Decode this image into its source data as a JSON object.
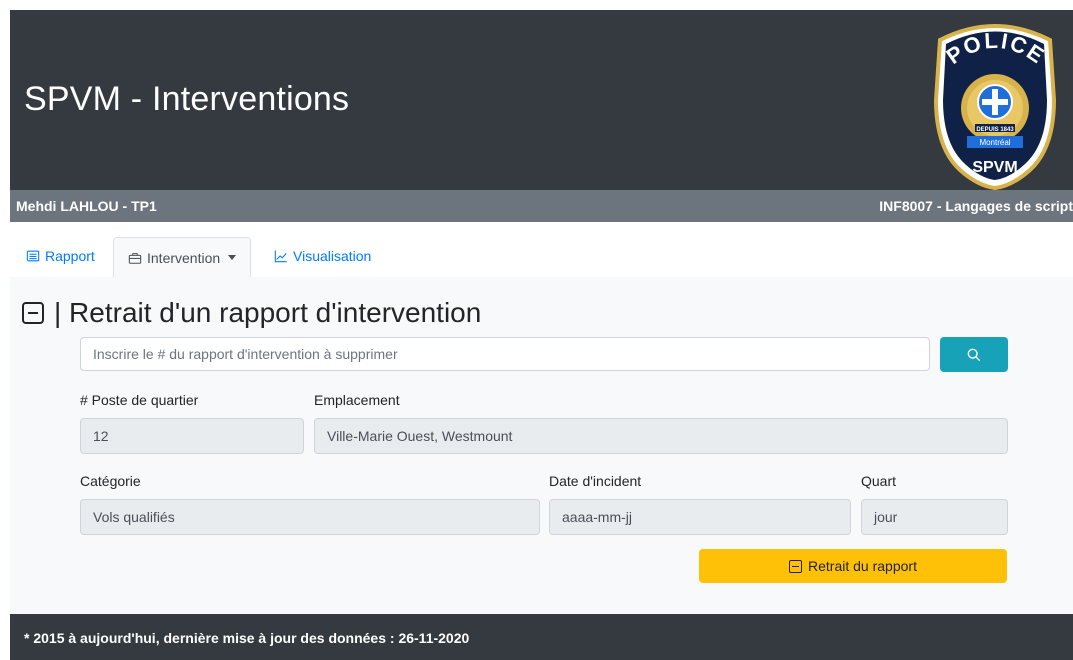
{
  "header": {
    "title": "SPVM - Interventions",
    "badge": {
      "top_text": "POLICE",
      "ribbon_top": "DEPUIS 1843",
      "ribbon_city": "Montréal",
      "bottom_text": "SPVM",
      "colors": {
        "badge_bg": "#0f2147",
        "gold": "#d8b24a",
        "blue": "#1e6fd9"
      }
    }
  },
  "subbar": {
    "left": "Mehdi LAHLOU - TP1",
    "right": "INF8007 - Langages de script"
  },
  "tabs": [
    {
      "label": "Rapport",
      "icon": "list-icon"
    },
    {
      "label": "Intervention",
      "icon": "briefcase-icon",
      "active": true,
      "dropdown": true
    },
    {
      "label": "Visualisation",
      "icon": "chart-line-icon"
    }
  ],
  "main": {
    "title": "| Retrait d'un rapport d'intervention",
    "search": {
      "placeholder": "Inscrire le # du rapport d'intervention à supprimer",
      "value": ""
    },
    "fields": {
      "poste": {
        "label": "# Poste de quartier",
        "value": "12"
      },
      "emplacement": {
        "label": "Emplacement",
        "value": "Ville-Marie Ouest, Westmount"
      },
      "categorie": {
        "label": "Catégorie",
        "value": "Vols qualifiés"
      },
      "date": {
        "label": "Date d'incident",
        "value": "aaaa-mm-jj"
      },
      "quart": {
        "label": "Quart",
        "value": "jour"
      }
    },
    "action_button": "Retrait du rapport"
  },
  "footer": {
    "text": "* 2015 à aujourd'hui, dernière mise à jour des données : 26-11-2020"
  },
  "colors": {
    "dark": "#343a40",
    "gray": "#6c757d",
    "link": "#007bff",
    "info": "#17a2b8",
    "warning": "#ffc107",
    "panel": "#f8f9fa"
  }
}
